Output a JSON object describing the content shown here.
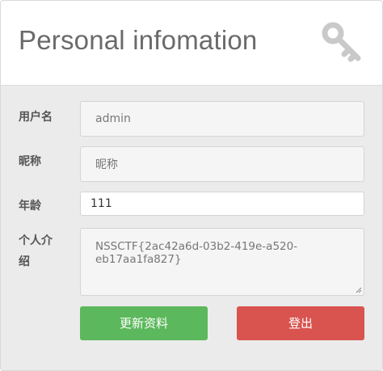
{
  "header": {
    "title": "Personal infomation",
    "icon": "key-icon"
  },
  "form": {
    "username": {
      "label": "用户名",
      "value": "admin"
    },
    "nickname": {
      "label": "昵称",
      "placeholder": "昵称"
    },
    "age": {
      "label": "年龄",
      "value": "111"
    },
    "bio": {
      "label": "个人介绍",
      "value": "NSSCTF{2ac42a6d-03b2-419e-a520-eb17aa1fa827}"
    }
  },
  "buttons": {
    "update": "更新资料",
    "logout": "登出"
  },
  "colors": {
    "update": "#5cb85c",
    "logout": "#d9534f",
    "background": "#ebebeb"
  }
}
